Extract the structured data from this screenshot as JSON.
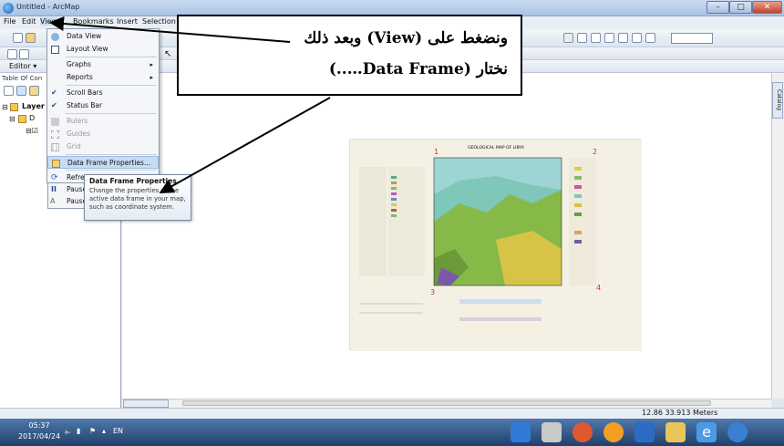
{
  "window": {
    "title": "Untitled - ArcMap"
  },
  "menubar": {
    "items": [
      "File",
      "Edit",
      "View",
      "Bookmarks",
      "Insert",
      "Selection"
    ]
  },
  "toolbar": {
    "editor_label": "Editor ▾",
    "scale_value": ""
  },
  "toc": {
    "title": "Table Of Con",
    "layers_label": "Layer",
    "dataframe_label": "D"
  },
  "view_menu": {
    "items": [
      {
        "label": "Data View",
        "icon": "globe-icon",
        "enabled": true
      },
      {
        "label": "Layout View",
        "icon": "layout-icon",
        "enabled": true
      },
      {
        "label": "Graphs",
        "icon": "",
        "enabled": true,
        "submenu": true
      },
      {
        "label": "Reports",
        "icon": "",
        "enabled": true,
        "submenu": true
      },
      {
        "label": "Scroll Bars",
        "icon": "check",
        "enabled": true
      },
      {
        "label": "Status Bar",
        "icon": "check",
        "enabled": true
      },
      {
        "label": "Rulers",
        "icon": "ruler-icon",
        "enabled": false
      },
      {
        "label": "Guides",
        "icon": "guides-icon",
        "enabled": false
      },
      {
        "label": "Grid",
        "icon": "grid-icon",
        "enabled": false
      },
      {
        "label": "Data Frame Properties...",
        "icon": "properties-icon",
        "enabled": true,
        "highlighted": true
      },
      {
        "label": "Refresh",
        "icon": "refresh-icon",
        "enabled": true,
        "shortcut": "F5"
      },
      {
        "label": "Pause Drawing",
        "icon": "pause-icon",
        "enabled": true
      },
      {
        "label": "Pause Labeling",
        "icon": "pause-label-icon",
        "enabled": true
      }
    ]
  },
  "tooltip": {
    "title": "Data Frame Properties",
    "body": "Change the properties of the active data frame in your map, such as coordinate system."
  },
  "annotation": {
    "line1": "ونضغط على (View) وبعد ذلك",
    "line2": "نختار (Data Frame…..)"
  },
  "map": {
    "title": "GEOLOGICAL MAP OF LIBYA",
    "corner_numbers": [
      "1",
      "2",
      "3",
      "4"
    ]
  },
  "statusbar": {
    "coords": "12.86  33.913 Meters"
  },
  "taskbar": {
    "time": "05:37",
    "date": "2017/04/24",
    "lang": "EN"
  },
  "colors": {
    "accent": "#c7dcf4",
    "annotation_border": "#000000",
    "taskbar": "#2b4b78"
  }
}
